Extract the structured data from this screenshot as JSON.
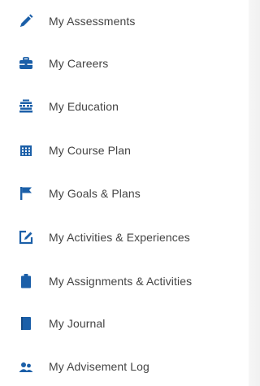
{
  "colors": {
    "icon": "#1b5fa8",
    "text": "#444444",
    "background": "#ffffff"
  },
  "menu": {
    "items": [
      {
        "label": "My Assessments",
        "icon": "pencil-icon"
      },
      {
        "label": "My Careers",
        "icon": "briefcase-icon"
      },
      {
        "label": "My Education",
        "icon": "building-icon"
      },
      {
        "label": "My Course Plan",
        "icon": "calendar-grid-icon"
      },
      {
        "label": "My Goals & Plans",
        "icon": "flag-icon"
      },
      {
        "label": "My Activities & Experiences",
        "icon": "edit-square-icon"
      },
      {
        "label": "My Assignments & Activities",
        "icon": "clipboard-icon"
      },
      {
        "label": "My Journal",
        "icon": "book-icon"
      },
      {
        "label": "My Advisement Log",
        "icon": "users-icon"
      }
    ]
  }
}
